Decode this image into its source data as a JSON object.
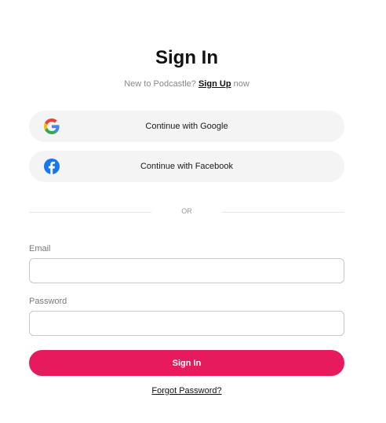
{
  "header": {
    "title": "Sign In",
    "subtitle_prefix": "New to Podcastle? ",
    "signup_link": "Sign Up",
    "subtitle_suffix": " now"
  },
  "social": {
    "google": {
      "label": "Continue with Google",
      "icon": "google-icon"
    },
    "facebook": {
      "label": "Continue with Facebook",
      "icon": "facebook-icon"
    }
  },
  "divider": {
    "text": "OR"
  },
  "form": {
    "email": {
      "label": "Email",
      "value": "",
      "placeholder": ""
    },
    "password": {
      "label": "Password",
      "value": "",
      "placeholder": ""
    },
    "submit_label": "Sign In",
    "forgot_label": "Forgot Password?"
  },
  "colors": {
    "accent": "#e61a5c",
    "button_bg": "#f4f4f4",
    "facebook_blue": "#1877f2"
  }
}
